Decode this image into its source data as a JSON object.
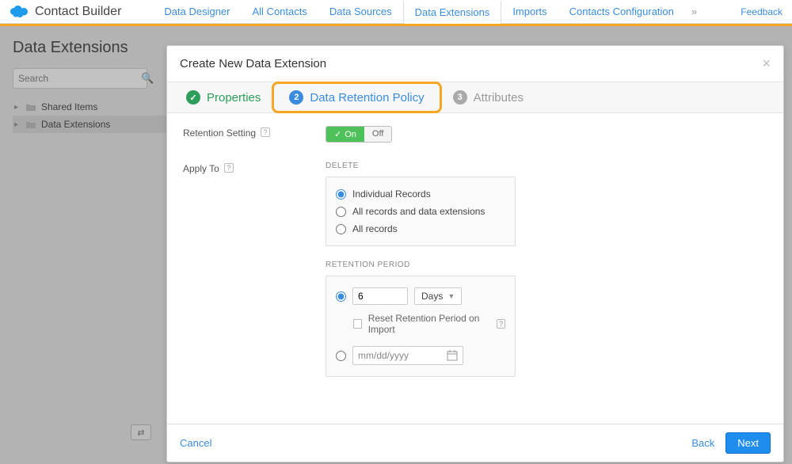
{
  "app_title": "Contact Builder",
  "nav": {
    "tabs": [
      "Data Designer",
      "All Contacts",
      "Data Sources",
      "Data Extensions",
      "Imports",
      "Contacts Configuration"
    ],
    "active_index": 3,
    "feedback": "Feedback"
  },
  "page": {
    "heading": "Data Extensions",
    "search_placeholder": "Search",
    "tree": {
      "items": [
        {
          "label": "Shared Items"
        },
        {
          "label": "Data Extensions"
        }
      ],
      "selected_index": 1
    }
  },
  "modal": {
    "title": "Create New Data Extension",
    "steps": {
      "s1": {
        "label": "Properties"
      },
      "s2": {
        "label": "Data Retention Policy",
        "badge": "2"
      },
      "s3": {
        "label": "Attributes",
        "badge": "3"
      }
    },
    "retention_setting_label": "Retention Setting",
    "toggle": {
      "on": "On",
      "off": "Off"
    },
    "apply_to_label": "Apply To",
    "delete_section": "DELETE",
    "delete_options": {
      "o1": "Individual Records",
      "o2": "All records and data extensions",
      "o3": "All records"
    },
    "period_section": "RETENTION PERIOD",
    "period_value": "6",
    "period_unit": "Days",
    "reset_label": "Reset Retention Period on Import",
    "date_placeholder": "mm/dd/yyyy",
    "footer": {
      "cancel": "Cancel",
      "back": "Back",
      "next": "Next"
    }
  }
}
